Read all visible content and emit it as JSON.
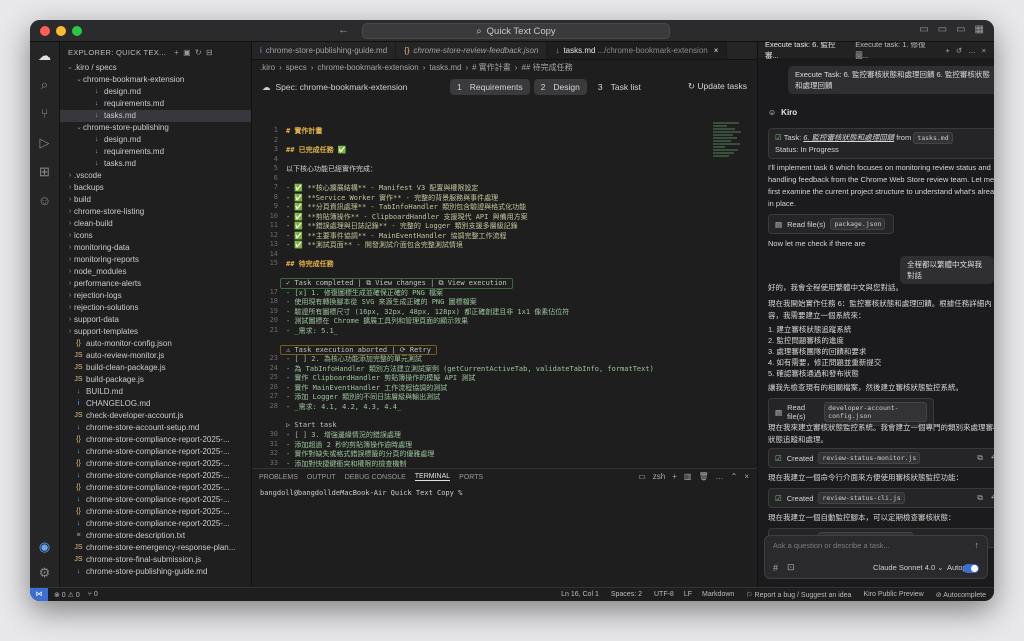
{
  "titlebar": {
    "search": "Quick Text Copy",
    "colors": {
      "close": "#ff5f57",
      "min": "#febc2e",
      "max": "#28c840"
    }
  },
  "sidebar": {
    "title": "EXPLORER: QUICK TEX...",
    "tree": [
      {
        "label": ".kiro / specs",
        "depth": 0,
        "type": "folder-open"
      },
      {
        "label": "chrome-bookmark-extension",
        "depth": 1,
        "type": "folder-open"
      },
      {
        "label": "design.md",
        "depth": 2,
        "type": "md"
      },
      {
        "label": "requirements.md",
        "depth": 2,
        "type": "md"
      },
      {
        "label": "tasks.md",
        "depth": 2,
        "type": "md",
        "selected": true
      },
      {
        "label": "chrome-store-publishing",
        "depth": 1,
        "type": "folder-open"
      },
      {
        "label": "design.md",
        "depth": 2,
        "type": "md"
      },
      {
        "label": "requirements.md",
        "depth": 2,
        "type": "md"
      },
      {
        "label": "tasks.md",
        "depth": 2,
        "type": "md"
      },
      {
        "label": ".vscode",
        "depth": 0,
        "type": "folder"
      },
      {
        "label": "backups",
        "depth": 0,
        "type": "folder"
      },
      {
        "label": "build",
        "depth": 0,
        "type": "folder"
      },
      {
        "label": "chrome-store-listing",
        "depth": 0,
        "type": "folder"
      },
      {
        "label": "clean-build",
        "depth": 0,
        "type": "folder"
      },
      {
        "label": "icons",
        "depth": 0,
        "type": "folder"
      },
      {
        "label": "monitoring-data",
        "depth": 0,
        "type": "folder"
      },
      {
        "label": "monitoring-reports",
        "depth": 0,
        "type": "folder"
      },
      {
        "label": "node_modules",
        "depth": 0,
        "type": "folder"
      },
      {
        "label": "performance-alerts",
        "depth": 0,
        "type": "folder"
      },
      {
        "label": "rejection-logs",
        "depth": 0,
        "type": "folder"
      },
      {
        "label": "rejection-solutions",
        "depth": 0,
        "type": "folder"
      },
      {
        "label": "support-data",
        "depth": 0,
        "type": "folder"
      },
      {
        "label": "support-templates",
        "depth": 0,
        "type": "folder"
      },
      {
        "label": "auto-monitor-config.json",
        "depth": 0,
        "type": "json"
      },
      {
        "label": "auto-review-monitor.js",
        "depth": 0,
        "type": "js"
      },
      {
        "label": "build-clean-package.js",
        "depth": 0,
        "type": "js"
      },
      {
        "label": "build-package.js",
        "depth": 0,
        "type": "js"
      },
      {
        "label": "BUILD.md",
        "depth": 0,
        "type": "md"
      },
      {
        "label": "CHANGELOG.md",
        "depth": 0,
        "type": "md-i"
      },
      {
        "label": "check-developer-account.js",
        "depth": 0,
        "type": "js"
      },
      {
        "label": "chrome-store-account-setup.md",
        "depth": 0,
        "type": "md"
      },
      {
        "label": "chrome-store-compliance-report-2025-...",
        "depth": 0,
        "type": "json"
      },
      {
        "label": "chrome-store-compliance-report-2025-...",
        "depth": 0,
        "type": "md"
      },
      {
        "label": "chrome-store-compliance-report-2025-...",
        "depth": 0,
        "type": "json"
      },
      {
        "label": "chrome-store-compliance-report-2025-...",
        "depth": 0,
        "type": "md"
      },
      {
        "label": "chrome-store-compliance-report-2025-...",
        "depth": 0,
        "type": "json"
      },
      {
        "label": "chrome-store-compliance-report-2025-...",
        "depth": 0,
        "type": "md"
      },
      {
        "label": "chrome-store-compliance-report-2025-...",
        "depth": 0,
        "type": "json"
      },
      {
        "label": "chrome-store-compliance-report-2025-...",
        "depth": 0,
        "type": "md"
      },
      {
        "label": "chrome-store-description.txt",
        "depth": 0,
        "type": "txt"
      },
      {
        "label": "chrome-store-emergency-response-plan...",
        "depth": 0,
        "type": "js"
      },
      {
        "label": "chrome-store-final-submission.js",
        "depth": 0,
        "type": "js"
      },
      {
        "label": "chrome-store-publishing-guide.md",
        "depth": 0,
        "type": "md"
      }
    ]
  },
  "editor": {
    "tabs": [
      {
        "label": "chrome-store-publishing-guide.md",
        "icon": "i",
        "suffix": ""
      },
      {
        "label": "chrome-store-review-feedback.json",
        "icon": "{}",
        "suffix": ""
      },
      {
        "label": "tasks.md",
        "icon": "↓",
        "suffix": ".../chrome-bookmark-extension",
        "active": true
      }
    ],
    "breadcrumb": [
      ".kiro",
      "specs",
      "chrome-bookmark-extension",
      "tasks.md",
      "# 實作計畫",
      "## 待完成任務"
    ],
    "spec_title": "Spec: chrome-bookmark-extension",
    "steps": [
      {
        "num": "1",
        "label": "Requirements"
      },
      {
        "num": "2",
        "label": "Design"
      },
      {
        "num": "3",
        "label": "Task list",
        "active": true
      }
    ],
    "update_tasks": "Update tasks",
    "lines": [
      {
        "n": "1",
        "t": "# 實作計畫",
        "c": "#e5b34a",
        "b": true
      },
      {
        "n": "2",
        "t": ""
      },
      {
        "n": "3",
        "t": "## 已完成任務 ✅",
        "c": "#e5b34a",
        "b": true
      },
      {
        "n": "4",
        "t": ""
      },
      {
        "n": "5",
        "t": "以下核心功能已經實作完成：",
        "c": "#d4d4d4"
      },
      {
        "n": "6",
        "t": ""
      },
      {
        "n": "7",
        "t": "- ✅ **核心擴展結構** - Manifest V3 配置與權限設定",
        "c": "#c7c59b"
      },
      {
        "n": "8",
        "t": "- ✅ **Service Worker 實作** - 完整的背景服務與事件處理",
        "c": "#c7c59b"
      },
      {
        "n": "9",
        "t": "- ✅ **分頁資訊處理** - TabInfoHandler 類別包含驗證與格式化功能",
        "c": "#c7c59b"
      },
      {
        "n": "10",
        "t": "- ✅ **剪貼簿操作** - ClipboardHandler 支援現代 API 與備用方案",
        "c": "#c7c59b"
      },
      {
        "n": "11",
        "t": "- ✅ **錯誤處理與日誌記錄** - 完整的 Logger 類別支援多層級記錄",
        "c": "#c7c59b"
      },
      {
        "n": "12",
        "t": "- ✅ **主要事件協調** - MainEventHandler 協調完整工作流程",
        "c": "#c7c59b"
      },
      {
        "n": "13",
        "t": "- ✅ **測試頁面** - 開發測試介面包含完整測試情境",
        "c": "#c7c59b"
      },
      {
        "n": "14",
        "t": ""
      },
      {
        "n": "15",
        "t": "## 待完成任務",
        "c": "#e5b34a",
        "b": true
      },
      {
        "n": "",
        "t": ""
      },
      {
        "n": "",
        "t": "✓ Task completed | ⧉ View changes | ⧉ View execution",
        "c": "#c0c0c0",
        "box": "green"
      },
      {
        "n": "17",
        "t": "- [x] 1. 修復圖標生成並確保正確的 PNG 檔案",
        "c": "#9cc49c"
      },
      {
        "n": "18",
        "t": "  - 使用現有轉換腳本從 SVG 來源生成正確的 PNG 圖標檔案",
        "c": "#9cc49c"
      },
      {
        "n": "19",
        "t": "  - 驗證所有圖標尺寸 (16px, 32px, 48px, 128px) 都正確創建且非 1x1 像素佔位符",
        "c": "#9cc49c"
      },
      {
        "n": "20",
        "t": "  - 測試圖標在 Chrome 擴展工具列和管理頁面的顯示效果",
        "c": "#9cc49c"
      },
      {
        "n": "21",
        "t": "  - _需求: 5.1_",
        "c": "#9cc49c"
      },
      {
        "n": "",
        "t": ""
      },
      {
        "n": "",
        "t": "⚠ Task execution aborted | ⟳ Retry",
        "c": "#c0c0c0",
        "box": "amber"
      },
      {
        "n": "23",
        "t": "- [ ] 2. 為核心功能添加完整的單元測試",
        "c": "#9cc49c"
      },
      {
        "n": "24",
        "t": "  - 為 TabInfoHandler 類別方法建立測試案例 (getCurrentActiveTab, validateTabInfo, formatText)",
        "c": "#9cc49c"
      },
      {
        "n": "25",
        "t": "  - 實作 ClipboardHandler 剪貼簿操作的模擬 API 測試",
        "c": "#9cc49c"
      },
      {
        "n": "26",
        "t": "  - 實作 MainEventHandler 工作流程協調的測試",
        "c": "#9cc49c"
      },
      {
        "n": "27",
        "t": "  - 添加 Logger 類別的不同日誌層級與輸出測試",
        "c": "#9cc49c"
      },
      {
        "n": "28",
        "t": "  - _需求: 4.1, 4.2, 4.3, 4.4_",
        "c": "#9cc49c"
      },
      {
        "n": "",
        "t": ""
      },
      {
        "n": "",
        "t": "▷ Start task",
        "c": "#c0c0c0"
      },
      {
        "n": "30",
        "t": "- [ ] 3. 增強邊緣情況的錯誤處理",
        "c": "#9cc49c"
      },
      {
        "n": "31",
        "t": "  - 添加超過 2 秒的剪貼簿操作逾時處理",
        "c": "#9cc49c"
      },
      {
        "n": "32",
        "t": "  - 實作對缺失或格式錯誤標籤的分頁的優雅處理",
        "c": "#9cc49c"
      },
      {
        "n": "33",
        "t": "  - 添加對快捷鍵衝突和權限的檢查機制",
        "c": "#9cc49c"
      }
    ]
  },
  "panel": {
    "tabs": [
      "PROBLEMS",
      "OUTPUT",
      "DEBUG CONSOLE",
      "TERMINAL",
      "PORTS"
    ],
    "active_tab": "TERMINAL",
    "shell": "zsh",
    "prompt": "bangdoll@bangdolldeMacBook-Air Quick Text Copy %"
  },
  "chat": {
    "tabs": [
      "Execute task: 6. 監控審...",
      "Execute task: 1. 修復圖..."
    ],
    "user_msg_1": "Execute Task: 6. 監控審核狀態和處理回饋 6. 監控審核狀態和處理回饋",
    "agent_name": "Kiro",
    "task_prefix": "Task: ",
    "task_title": "6. 監控審核狀態和處理回饋",
    "task_from": "from",
    "task_file": "tasks.md",
    "task_status": "Status: In Progress",
    "intro": "I'll implement task 6 which focuses on monitoring review status and handling feedback from the Chrome Web Store review team. Let me first examine the current project structure to understand what's already in place.",
    "read_label": "Read file(s)",
    "read_file_1": "package.json",
    "check_msg": "Now let me check if there are",
    "user_msg_2": "全程都以繁體中文與我對話",
    "zh_1": "好的，我會全程使用繁體中文與您對話。",
    "zh_2": "現在我開始實作任務 6：監控審核狀態和處理回饋。根據任務詳細內容，我需要建立一個系統來：",
    "list": [
      "1. 建立審核狀態追蹤系統",
      "2. 監控問題審核的進度",
      "3. 處理審核團隊的回饋和要求",
      "4. 如有需要，修正問題並重新提交",
      "5. 確認審核通過和發布狀態"
    ],
    "zh_3": "讓我先檢查現有的相關檔案，然後建立審核狀態監控系統。",
    "read_file_2": "developer-account-config.json",
    "zh_4": "現在我來建立審核狀態監控系統。我會建立一個專門的類別來處理審核狀態追蹤和處理。",
    "created_label": "Created",
    "created_1": "review-status-monitor.js",
    "zh_5": "現在我建立一個命令行介面來方便使用審核狀態監控功能：",
    "created_2": "review-status-cli.js",
    "zh_6": "現在我建立一個自動監控腳本，可以定期檢查審核狀態：",
    "created_3": "auto-review-monitor.js",
    "input_placeholder": "Ask a question or describe a task...",
    "model": "Claude Sonnet 4.0",
    "autopilot": "Autopilot"
  },
  "statusbar": {
    "errors": "⊗ 0 ⚠ 0",
    "ports": "⑂ 0",
    "position": "Ln 16, Col 1",
    "spaces": "Spaces: 2",
    "encoding": "UTF-8",
    "eol": "LF",
    "language": "Markdown",
    "report": "Report a bug / Suggest an idea",
    "edition": "Kiro Public Preview",
    "autocomplete": "Autocomplete"
  }
}
